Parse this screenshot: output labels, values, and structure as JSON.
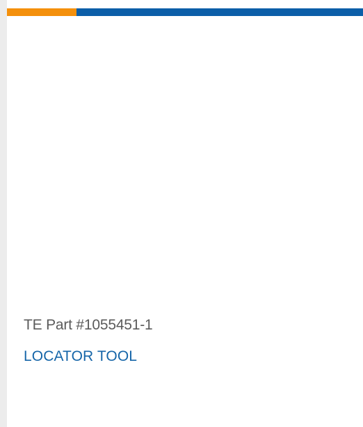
{
  "colors": {
    "accent_orange": "#f4900c",
    "accent_blue": "#0b5ea8",
    "link": "#1565a8",
    "text": "#5b5b5b"
  },
  "card": {
    "part_number": "TE Part #1055451-1",
    "link_label": "LOCATOR TOOL"
  }
}
